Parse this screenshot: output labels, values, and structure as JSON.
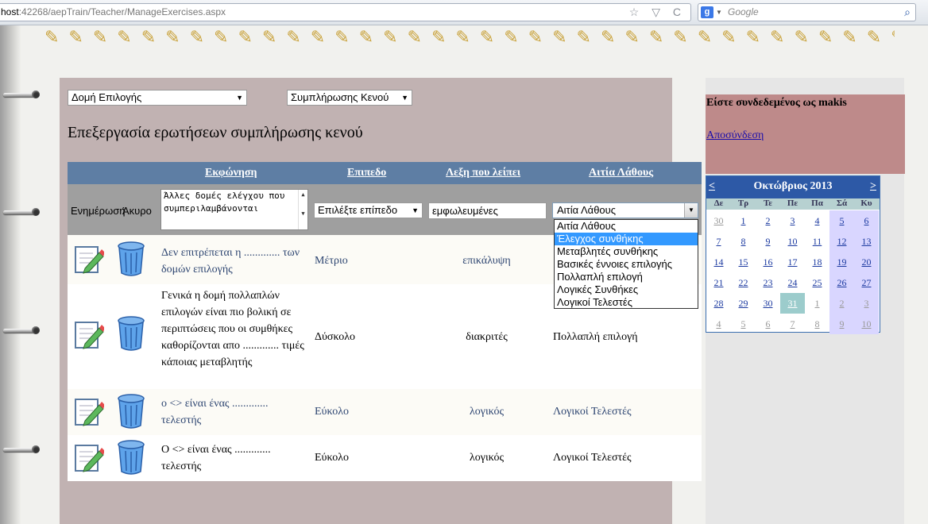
{
  "browser": {
    "url_host": "host",
    "url_path": ":42268/aepTrain/Teacher/ManageExercises.aspx",
    "url_buttons": "☆ ▽ C",
    "search_engine": "g",
    "search_placeholder": "Google",
    "search_icon": "magnifier-icon"
  },
  "filters": {
    "topic_select": "Δομή Επιλογής",
    "type_select": "Συμπλήρωσης Κενού"
  },
  "page_title": "Επεξεργασία ερωτήσεων συμπλήρωσης κενού",
  "grid": {
    "headers": {
      "question": "Εκφώνηση",
      "level": "Επιπεδο",
      "missing_word": "Λεξη που λείπει",
      "error_cause": "Αιτία Λάθους"
    },
    "edit_row": {
      "update_label": "Ενημέρωση",
      "cancel_label": "Άκυρο",
      "question_value": "Άλλες δομές ελέγχου που συμπεριλαμβάνονται",
      "level_select": "Επιλέξτε επίπεδο",
      "missing_word_value": "εμφωλευμένες",
      "cause_select": "Αιτία Λάθους"
    },
    "cause_options": [
      "Αιτία Λάθους",
      "Έλεγχος συνθήκης",
      "Μεταβλητές συνθήκης",
      "Βασικές έννοιες επιλογής",
      "Πολλαπλή επιλογή",
      "Λογικές Συνθήκες",
      "Λογικοί Τελεστές"
    ],
    "rows": [
      {
        "question": "Δεν επιτρέπεται η ............. των δομών επιλογής",
        "level": "Μέτριο",
        "word": "επικάλυψη",
        "cause": ""
      },
      {
        "question": "Γενικά η δομή πολλαπλών επιλογών είναι πιο βολική σε περιπτώσεις που οι συμθήκες καθορίζονται απο ............. τιμές κάποιας μεταβλητής",
        "level": "Δύσκολο",
        "word": "διακριτές",
        "cause": "Πολλαπλή επιλογή"
      },
      {
        "question": "ο <> είναι ένας ............. τελεστής",
        "level": "Εύκολο",
        "word": "λογικός",
        "cause": "Λογικοί Τελεστές"
      },
      {
        "question": "Ο <> είναι ένας ............. τελεστής",
        "level": "Εύκολο",
        "word": "λογικός",
        "cause": "Λογικοί Τελεστές"
      }
    ]
  },
  "sidebar": {
    "login_text": "Είστε συνδεδεμένος ως makis",
    "logout": "Αποσύνδεση"
  },
  "calendar": {
    "prev": "<",
    "next": ">",
    "title": "Οκτώβριος 2013",
    "days_of_week": [
      "Δε",
      "Τρ",
      "Τε",
      "Πε",
      "Πα",
      "Σά",
      "Κυ"
    ],
    "weeks": [
      [
        "30",
        "1",
        "2",
        "3",
        "4",
        "5",
        "6"
      ],
      [
        "7",
        "8",
        "9",
        "10",
        "11",
        "12",
        "13"
      ],
      [
        "14",
        "15",
        "16",
        "17",
        "18",
        "19",
        "20"
      ],
      [
        "21",
        "22",
        "23",
        "24",
        "25",
        "26",
        "27"
      ],
      [
        "28",
        "29",
        "30",
        "31",
        "1",
        "2",
        "3"
      ],
      [
        "4",
        "5",
        "6",
        "7",
        "8",
        "9",
        "10"
      ]
    ],
    "today": "31",
    "colors": {
      "header": "#2d59a6",
      "weekend": "#d9d6ff",
      "today": "#9ccccc"
    }
  }
}
